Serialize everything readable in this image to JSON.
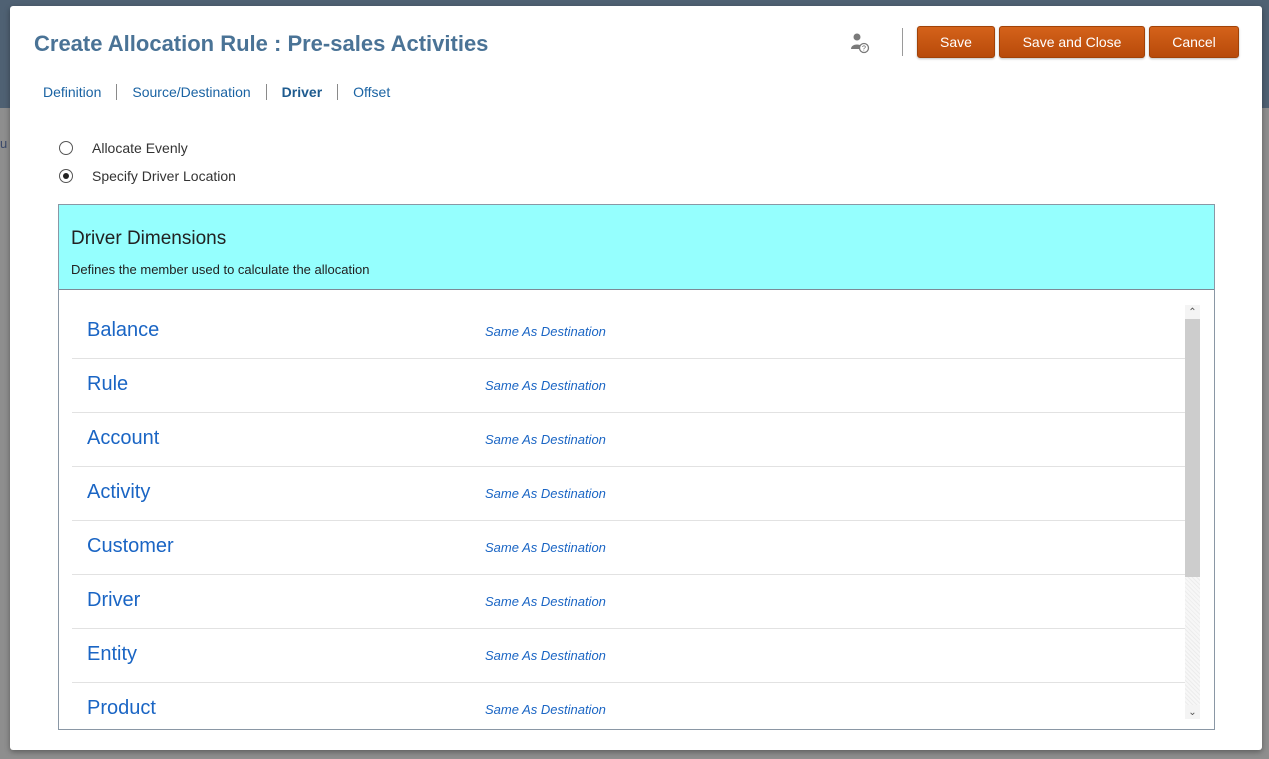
{
  "background_fragment": "u",
  "dialog": {
    "title": "Create Allocation Rule : Pre-sales Activities",
    "buttons": {
      "save": "Save",
      "save_and_close": "Save and Close",
      "cancel": "Cancel"
    },
    "tabs": [
      {
        "label": "Definition",
        "active": false
      },
      {
        "label": "Source/Destination",
        "active": false
      },
      {
        "label": "Driver",
        "active": true
      },
      {
        "label": "Offset",
        "active": false
      }
    ],
    "options": [
      {
        "label": "Allocate Evenly",
        "selected": false
      },
      {
        "label": "Specify Driver Location",
        "selected": true
      }
    ],
    "panel": {
      "title": "Driver Dimensions",
      "subtitle": "Defines the member used to calculate the allocation",
      "rows": [
        {
          "name": "Balance",
          "value": "Same As Destination"
        },
        {
          "name": "Rule",
          "value": "Same As Destination"
        },
        {
          "name": "Account",
          "value": "Same As Destination"
        },
        {
          "name": "Activity",
          "value": "Same As Destination"
        },
        {
          "name": "Customer",
          "value": "Same As Destination"
        },
        {
          "name": "Driver",
          "value": "Same As Destination"
        },
        {
          "name": "Entity",
          "value": "Same As Destination"
        },
        {
          "name": "Product",
          "value": "Same As Destination"
        }
      ]
    }
  },
  "colors": {
    "header_bg": "#95fffe",
    "button_orange": "#c6561a",
    "link_blue": "#1a65c4",
    "title_blue": "#4a7396"
  },
  "icons": {
    "help": "user-help-icon",
    "scroll_up": "chevron-up-icon",
    "scroll_down": "chevron-down-icon"
  }
}
